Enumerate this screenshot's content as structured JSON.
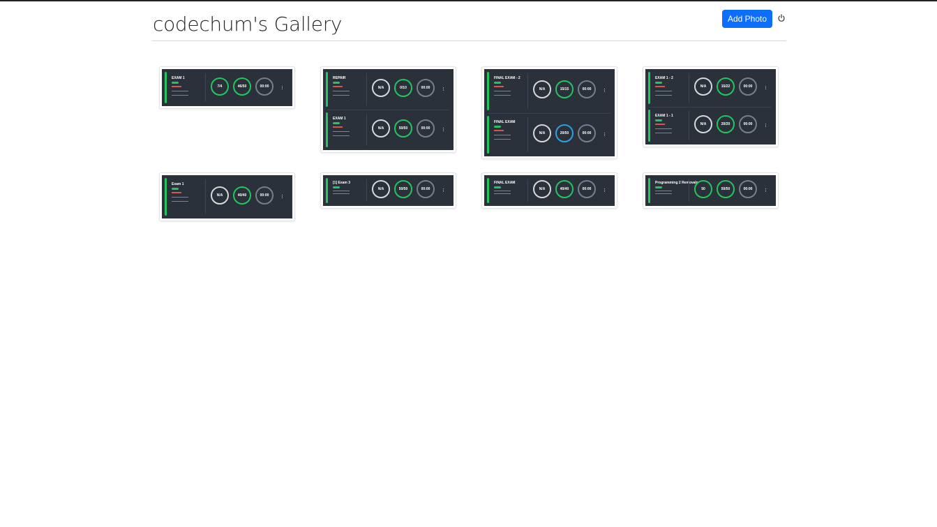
{
  "header": {
    "title": "codechum's Gallery",
    "add_photo_label": "Add Photo",
    "power_icon": "power-icon"
  },
  "gallery": {
    "photos": [
      {
        "panels": [
          {
            "name": "EXAM 1",
            "rings": [
              "7/4",
              "46/50",
              "00:00"
            ]
          }
        ]
      },
      {
        "panels": [
          {
            "name": "REPAIR",
            "rings": [
              "N/A",
              "0/10",
              "00:00"
            ]
          },
          {
            "name": "EXAM 1",
            "rings": [
              "N/A",
              "50/50",
              "00:00"
            ]
          }
        ]
      },
      {
        "panels": [
          {
            "name": "FINAL EXAM - 2",
            "rings": [
              "N/A",
              "15/15",
              "00:00"
            ]
          },
          {
            "name": "FINAL EXAM",
            "rings": [
              "N/A",
              "20/50",
              "00:00"
            ]
          }
        ]
      },
      {
        "panels": [
          {
            "name": "EXAM 1 - 2",
            "rings": [
              "N/A",
              "15/22",
              "00:00"
            ]
          },
          {
            "name": "EXAM 1 - 1",
            "rings": [
              "N/A",
              "20/20",
              "00:00"
            ]
          }
        ]
      },
      {
        "panels": [
          {
            "name": "Exam 1",
            "rings": [
              "N/A",
              "40/40",
              "00:00"
            ]
          }
        ]
      },
      {
        "panels": [
          {
            "name": "[1] Exam 3",
            "rings": [
              "N/A",
              "50/50",
              "00:00"
            ]
          }
        ]
      },
      {
        "panels": [
          {
            "name": "FINAL EXAM",
            "rings": [
              "N/A",
              "40/40",
              "00:00"
            ]
          }
        ]
      },
      {
        "panels": [
          {
            "name": "Programming 2 Removals",
            "rings": [
              "50",
              "50/50",
              "00:00"
            ]
          }
        ]
      }
    ]
  }
}
